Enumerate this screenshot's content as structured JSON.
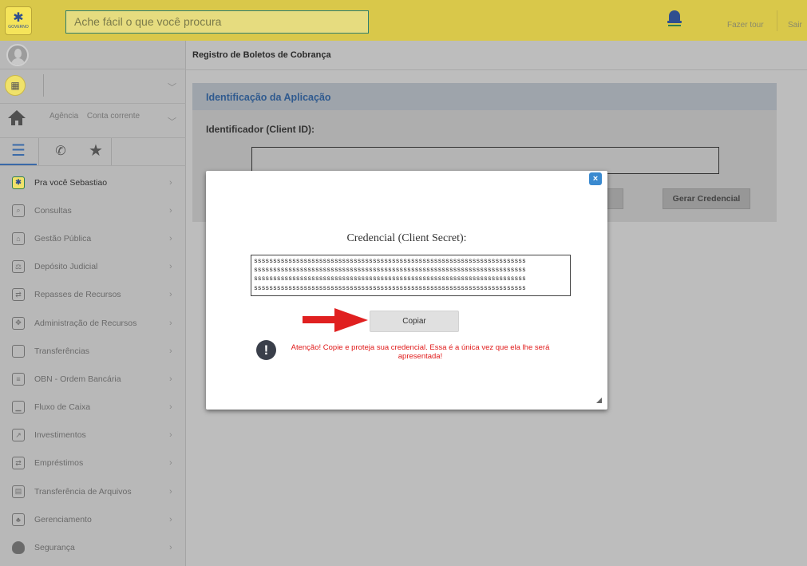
{
  "topbar": {
    "logo_text": "GOVERNO",
    "search_placeholder": "Ache fácil o que você procura",
    "tour_label": "Fazer tour",
    "exit_label": "Sair"
  },
  "sidebar": {
    "account": {
      "agency_label": "Agência",
      "account_label": "Conta corrente"
    },
    "menu": [
      {
        "label": "Pra você Sebastiao",
        "icon": "flag-icon"
      },
      {
        "label": "Consultas",
        "icon": "search-doc-icon"
      },
      {
        "label": "Gestão Pública",
        "icon": "bank-icon"
      },
      {
        "label": "Depósito Judicial",
        "icon": "scale-icon"
      },
      {
        "label": "Repasses de Recursos",
        "icon": "transfer-docs-icon"
      },
      {
        "label": "Administração de Recursos",
        "icon": "gear-shield-icon"
      },
      {
        "label": "Transferências",
        "icon": "transfer-icon"
      },
      {
        "label": "OBN - Ordem Bancária",
        "icon": "document-icon"
      },
      {
        "label": "Fluxo de Caixa",
        "icon": "area-chart-icon"
      },
      {
        "label": "Investimentos",
        "icon": "line-chart-icon"
      },
      {
        "label": "Empréstimos",
        "icon": "loan-icon"
      },
      {
        "label": "Transferência de Arquivos",
        "icon": "files-icon"
      },
      {
        "label": "Gerenciamento",
        "icon": "org-chart-icon"
      },
      {
        "label": "Segurança",
        "icon": "shield-icon"
      }
    ]
  },
  "header": {
    "title": "Registro de Boletos de Cobrança"
  },
  "card": {
    "title": "Identificação da Aplicação",
    "client_id_label": "Identificador (Client ID):",
    "client_id_value": "",
    "generate_button": "Gerar Credencial"
  },
  "modal": {
    "close_glyph": "×",
    "title": "Credencial (Client Secret):",
    "secret_lines": [
      "sssssssssssssssssssssssssssssssssssssssssssssssssssssssssssssssssssssss",
      "sssssssssssssssssssssssssssssssssssssssssssssssssssssssssssssssssssssss",
      "sssssssssssssssssssssssssssssssssssssssssssssssssssssssssssssssssssssss",
      "sssssssssssssssssssssssssssssssssssssssssssssssssssssssssssssssssssssss"
    ],
    "copy_button": "Copiar",
    "warning": "Atenção! Copie e proteja sua credencial. Essa é a única vez que ela lhe será apresentada!"
  },
  "colors": {
    "topbar": "#d9c84a",
    "accent_blue": "#2f5a8f",
    "warning_red": "#e01a1a",
    "arrow_red": "#e02020"
  }
}
